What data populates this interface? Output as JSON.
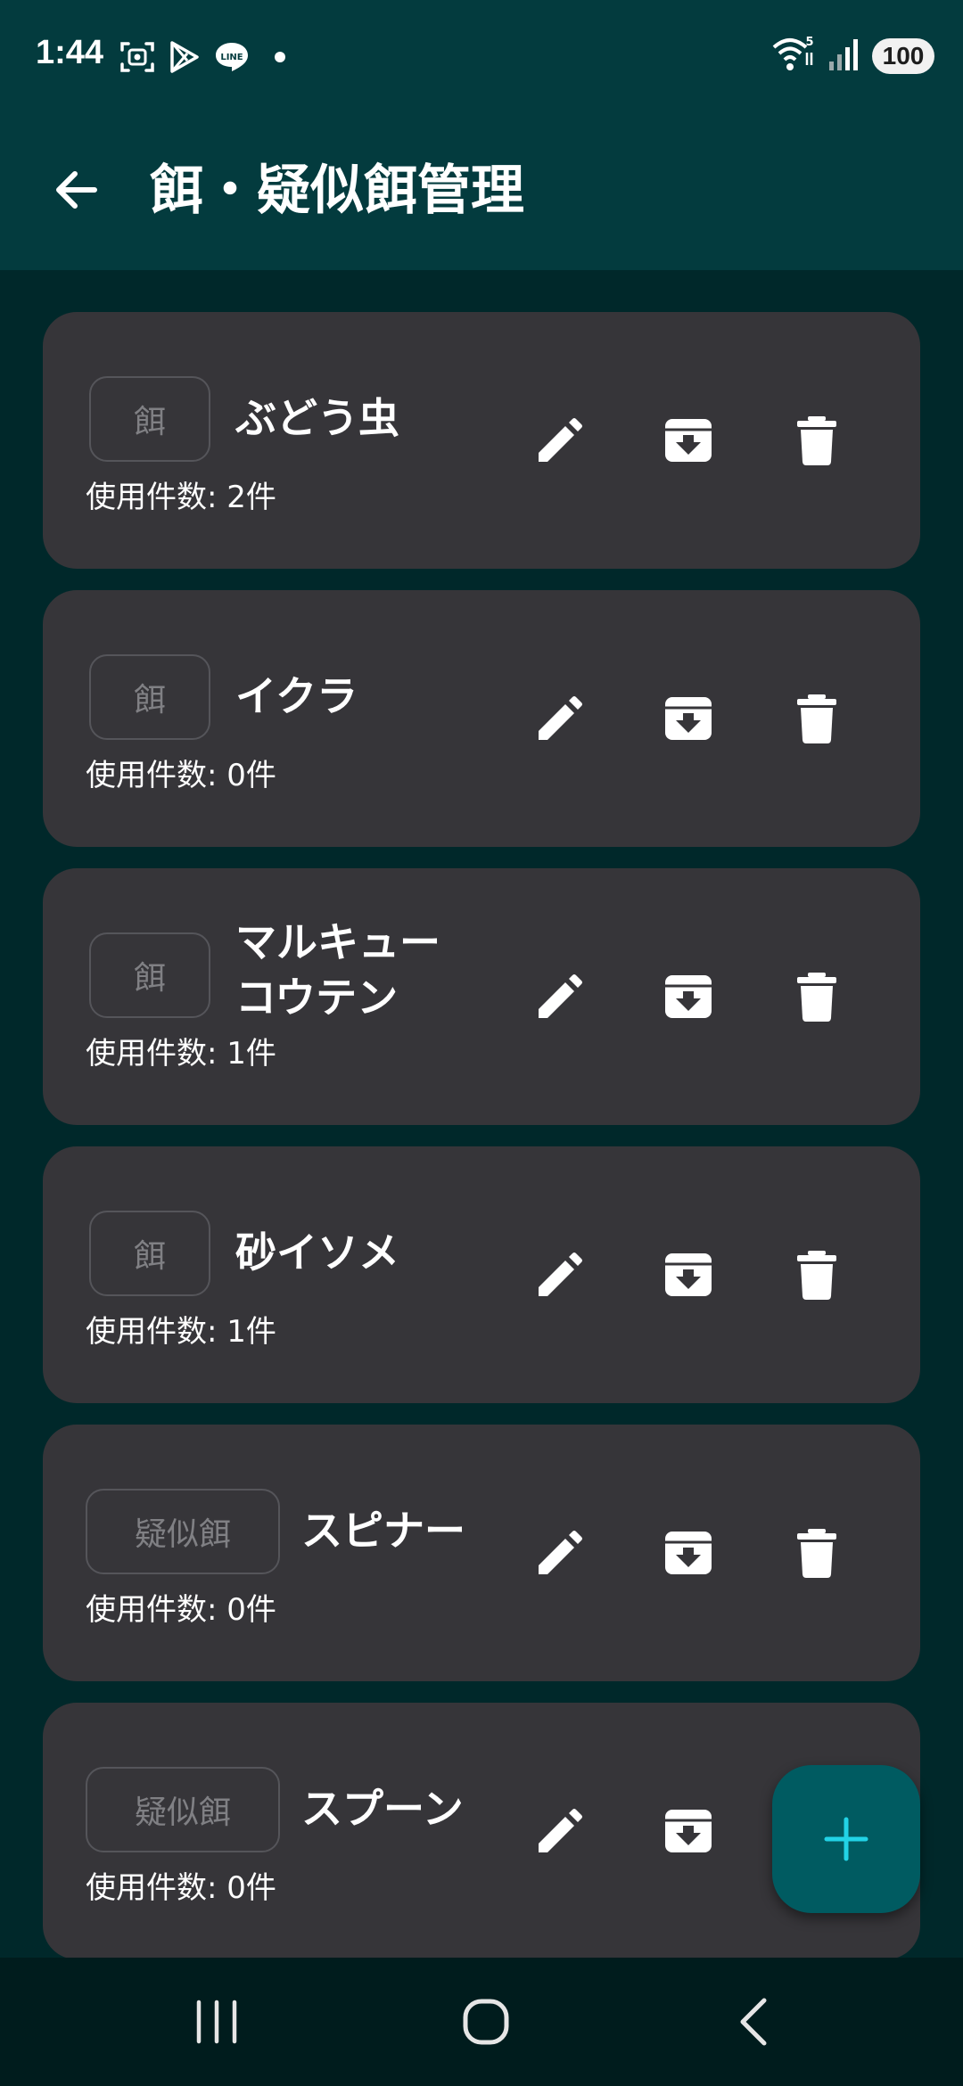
{
  "status_bar": {
    "time": "1:44",
    "battery": "100",
    "left_icons": [
      "screenshot-icon",
      "play-store-icon",
      "line-app-icon",
      "dot-icon"
    ],
    "right_icons": [
      "wifi-icon",
      "signal-icon",
      "battery-icon"
    ]
  },
  "app_bar": {
    "title": "餌・疑似餌管理",
    "back_icon": "arrow-back-icon"
  },
  "items": [
    {
      "type": "餌",
      "name": "ぶどう虫",
      "usage": "使用件数: 2件"
    },
    {
      "type": "餌",
      "name": "イクラ",
      "usage": "使用件数: 0件"
    },
    {
      "type": "餌",
      "name": "マルキューコウテン",
      "usage": "使用件数: 1件"
    },
    {
      "type": "餌",
      "name": "砂イソメ",
      "usage": "使用件数: 1件"
    },
    {
      "type": "疑似餌",
      "name": "スピナー",
      "usage": "使用件数: 0件"
    },
    {
      "type": "疑似餌",
      "name": "スプーン",
      "usage": "使用件数: 0件"
    }
  ],
  "actions": [
    "edit-icon",
    "archive-icon",
    "delete-icon"
  ],
  "fab": {
    "icon": "plus-icon"
  },
  "colors": {
    "background": "#00282a",
    "app_bar": "#033b3e",
    "card": "#363539",
    "fab": "#005b61",
    "fab_icon": "#22d3e6",
    "nav_bar": "#001c1d"
  },
  "nav": [
    "recents-icon",
    "home-icon",
    "back-icon"
  ]
}
